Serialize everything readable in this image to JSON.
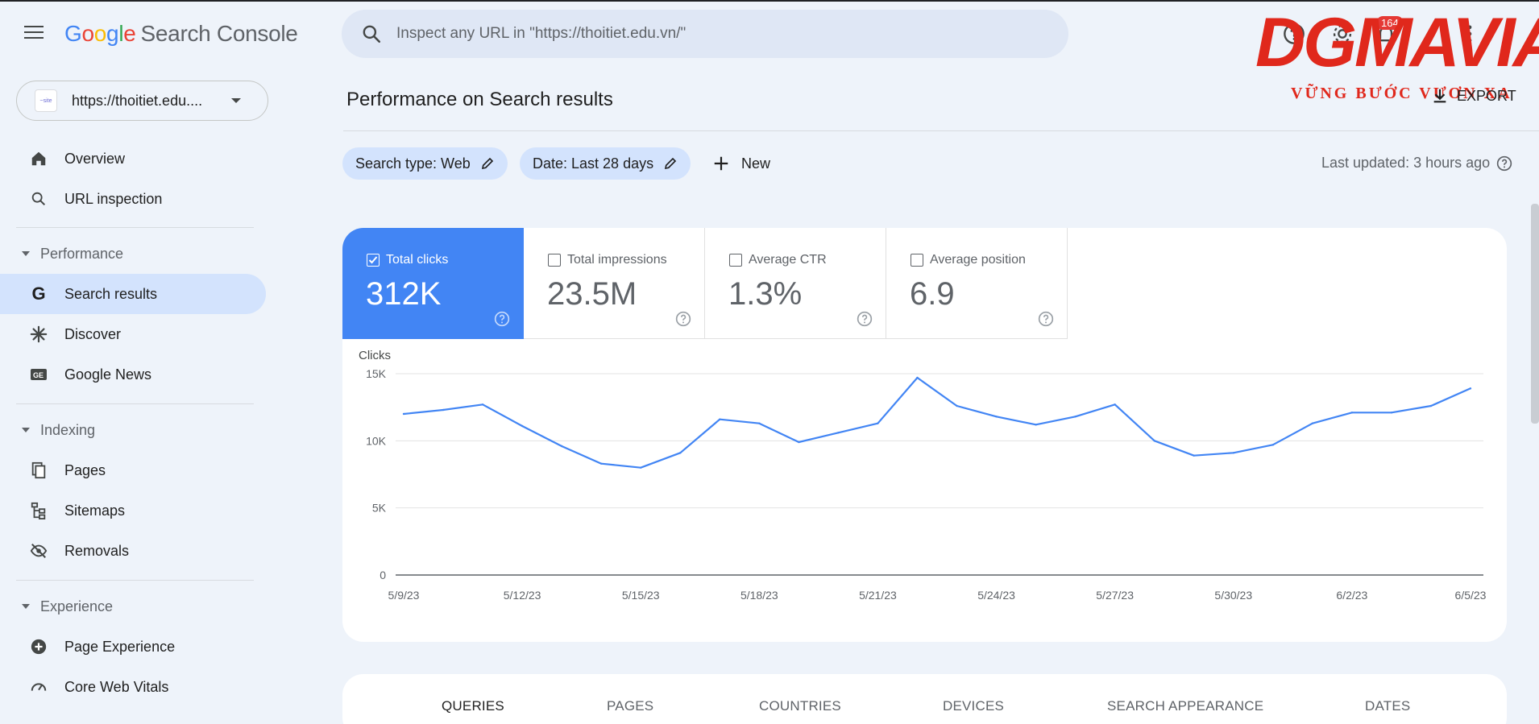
{
  "header": {
    "logo_google": [
      "G",
      "o",
      "o",
      "g",
      "l",
      "e"
    ],
    "logo_product": "Search Console",
    "search_placeholder": "Inspect any URL in \"https://thoitiet.edu.vn/\"",
    "notification_count": "164",
    "brand_overlay": {
      "name": "DGMAVIA",
      "slogan": "VỮNG BƯỚC VƯƠN XA"
    },
    "export_label": "EXPORT"
  },
  "property": {
    "url": "https://thoitiet.edu...."
  },
  "sidebar": {
    "items": [
      {
        "label": "Overview",
        "icon": "home-icon"
      },
      {
        "label": "URL inspection",
        "icon": "search-icon"
      }
    ],
    "sections": [
      {
        "label": "Performance",
        "items": [
          {
            "label": "Search results",
            "icon": "google-g-icon",
            "active": true
          },
          {
            "label": "Discover",
            "icon": "asterisk-icon"
          },
          {
            "label": "Google News",
            "icon": "news-icon"
          }
        ]
      },
      {
        "label": "Indexing",
        "items": [
          {
            "label": "Pages",
            "icon": "pages-icon"
          },
          {
            "label": "Sitemaps",
            "icon": "sitemap-icon"
          },
          {
            "label": "Removals",
            "icon": "eye-off-icon"
          }
        ]
      },
      {
        "label": "Experience",
        "items": [
          {
            "label": "Page Experience",
            "icon": "plus-circle-icon"
          },
          {
            "label": "Core Web Vitals",
            "icon": "gauge-icon"
          }
        ]
      }
    ]
  },
  "main": {
    "title": "Performance on Search results",
    "filters": {
      "search_type": "Search type: Web",
      "date": "Date: Last 28 days",
      "new": "New"
    },
    "last_updated": "Last updated: 3 hours ago",
    "metrics": [
      {
        "label": "Total clicks",
        "value": "312K",
        "selected": true
      },
      {
        "label": "Total impressions",
        "value": "23.5M",
        "selected": false
      },
      {
        "label": "Average CTR",
        "value": "1.3%",
        "selected": false
      },
      {
        "label": "Average position",
        "value": "6.9",
        "selected": false
      }
    ],
    "tabs": [
      "QUERIES",
      "PAGES",
      "COUNTRIES",
      "DEVICES",
      "SEARCH APPEARANCE",
      "DATES"
    ],
    "colors": {
      "accent": "#4285f4",
      "active_nav": "#d3e3fd",
      "background": "#eef3fa"
    }
  },
  "chart_data": {
    "type": "line",
    "title": "",
    "ylabel": "Clicks",
    "xlabel": "",
    "ylim": [
      0,
      15000
    ],
    "yticks": [
      0,
      5000,
      10000,
      15000
    ],
    "ytick_labels": [
      "0",
      "5K",
      "10K",
      "15K"
    ],
    "xtick_labels": [
      "5/9/23",
      "5/12/23",
      "5/15/23",
      "5/18/23",
      "5/21/23",
      "5/24/23",
      "5/27/23",
      "5/30/23",
      "6/2/23",
      "6/5/23"
    ],
    "x": [
      "5/9/23",
      "5/10/23",
      "5/11/23",
      "5/12/23",
      "5/13/23",
      "5/14/23",
      "5/15/23",
      "5/16/23",
      "5/17/23",
      "5/18/23",
      "5/19/23",
      "5/20/23",
      "5/21/23",
      "5/22/23",
      "5/23/23",
      "5/24/23",
      "5/25/23",
      "5/26/23",
      "5/27/23",
      "5/28/23",
      "5/29/23",
      "5/30/23",
      "5/31/23",
      "6/1/23",
      "6/2/23",
      "6/3/23",
      "6/4/23",
      "6/5/23"
    ],
    "series": [
      {
        "values": [
          12000,
          12300,
          12700,
          11100,
          9600,
          8300,
          8000,
          9100,
          11600,
          11300,
          9900,
          10600,
          11300,
          14700,
          12600,
          11800,
          11200,
          11800,
          12700,
          10000,
          8900,
          9100,
          9700,
          11300,
          12100,
          12100,
          12600,
          13900
        ],
        "color": "#4285f4"
      }
    ],
    "grid": true,
    "legend": "none"
  }
}
